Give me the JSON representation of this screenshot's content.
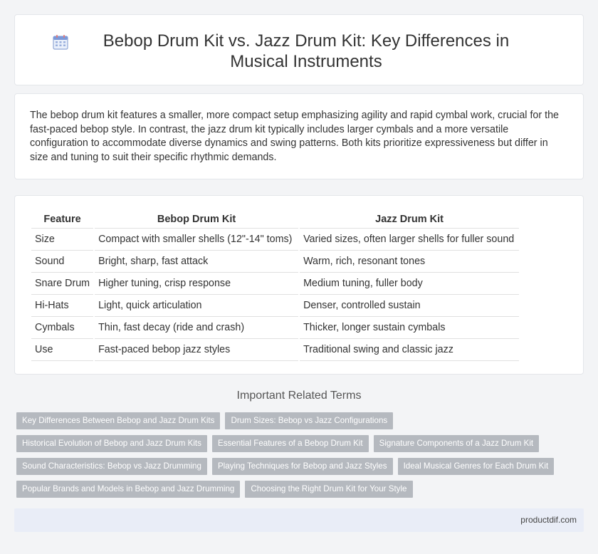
{
  "header": {
    "title": "Bebop Drum Kit vs. Jazz Drum Kit: Key Differences in Musical Instruments",
    "icon": "calendar-icon"
  },
  "intro": {
    "text": "The bebop drum kit features a smaller, more compact setup emphasizing agility and rapid cymbal work, crucial for the fast-paced bebop style. In contrast, the jazz drum kit typically includes larger cymbals and a more versatile configuration to accommodate diverse dynamics and swing patterns. Both kits prioritize expressiveness but differ in size and tuning to suit their specific rhythmic demands."
  },
  "table": {
    "headers": [
      "Feature",
      "Bebop Drum Kit",
      "Jazz Drum Kit"
    ],
    "rows": [
      [
        "Size",
        "Compact with smaller shells (12\"-14\" toms)",
        "Varied sizes, often larger shells for fuller sound"
      ],
      [
        "Sound",
        "Bright, sharp, fast attack",
        "Warm, rich, resonant tones"
      ],
      [
        "Snare Drum",
        "Higher tuning, crisp response",
        "Medium tuning, fuller body"
      ],
      [
        "Hi-Hats",
        "Light, quick articulation",
        "Denser, controlled sustain"
      ],
      [
        "Cymbals",
        "Thin, fast decay (ride and crash)",
        "Thicker, longer sustain cymbals"
      ],
      [
        "Use",
        "Fast-paced bebop jazz styles",
        "Traditional swing and classic jazz"
      ]
    ]
  },
  "related": {
    "title": "Important Related Terms",
    "rows": [
      [
        "Key Differences Between Bebop and Jazz Drum Kits",
        "Drum Sizes: Bebop vs Jazz Configurations"
      ],
      [
        "Historical Evolution of Bebop and Jazz Drum Kits",
        "Essential Features of a Bebop Drum Kit",
        "Signature Components of a Jazz Drum Kit"
      ],
      [
        "Sound Characteristics: Bebop vs Jazz Drumming",
        "Playing Techniques for Bebop and Jazz Styles",
        "Ideal Musical Genres for Each Drum Kit"
      ],
      [
        "Popular Brands and Models in Bebop and Jazz Drumming",
        "Choosing the Right Drum Kit for Your Style"
      ]
    ]
  },
  "footer": {
    "site": "productdif.com"
  },
  "colors": {
    "tag_bg": "#b5b9bf",
    "footer_bg": "#e9edf7",
    "page_bg": "#f3f4f6"
  }
}
